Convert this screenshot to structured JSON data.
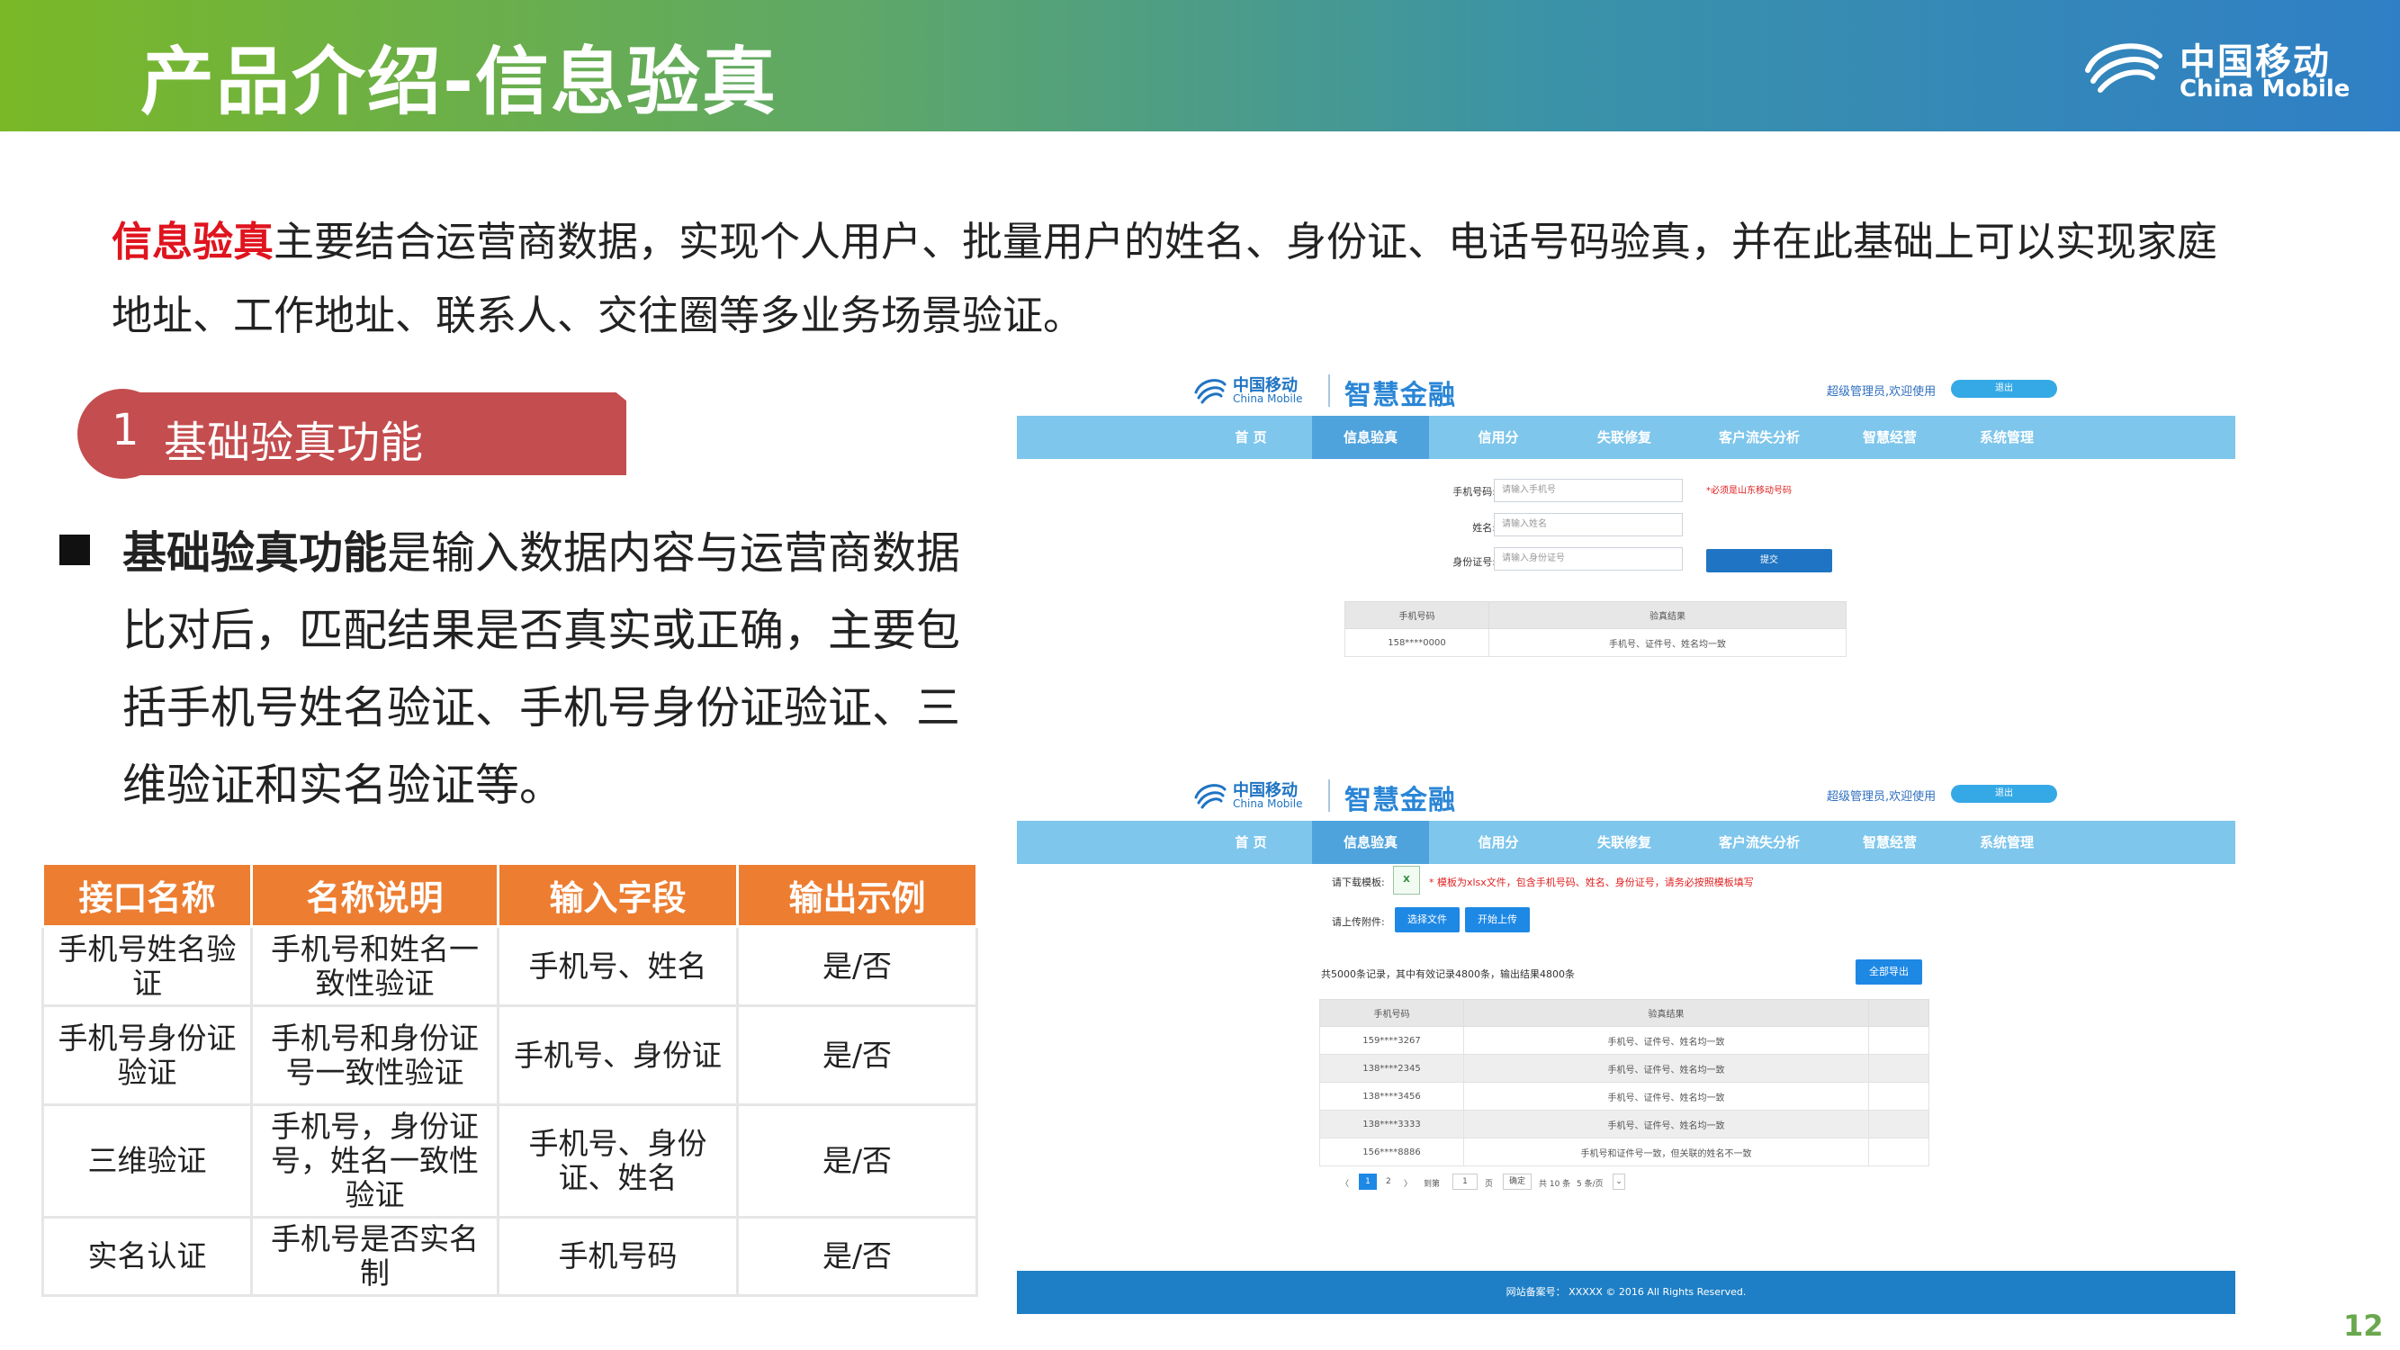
{
  "header": {
    "title": "产品介绍-信息验真",
    "brand_cn": "中国移动",
    "brand_en": "China Mobile"
  },
  "intro": {
    "highlight": "信息验真",
    "text": "主要结合运营商数据，实现个人用户、批量用户的姓名、身份证、电话号码验真，并在此基础上可以实现家庭地址、工作地址、联系人、交往圈等多业务场景验证。"
  },
  "section": {
    "number": "1",
    "label": "基础验真功能"
  },
  "bullet": {
    "bold": "基础验真功能",
    "text": "是输入数据内容与运营商数据比对后，匹配结果是否真实或正确，主要包括手机号姓名验证、手机号身份证验证、三维验证和实名验证等。"
  },
  "interface_table": {
    "headers": [
      "接口名称",
      "名称说明",
      "输入字段",
      "输出示例"
    ],
    "rows": [
      [
        "手机号姓名验证",
        "手机号和姓名一致性验证",
        "手机号、姓名",
        "是/否"
      ],
      [
        "手机号身份证验证",
        "手机号和身份证号一致性验证",
        "手机号、身份证",
        "是/否"
      ],
      [
        "三维验证",
        "手机号，身份证号，姓名一致性验证",
        "手机号、身份证、姓名",
        "是/否"
      ],
      [
        "实名认证",
        "手机号是否实名制",
        "手机号码",
        "是/否"
      ]
    ]
  },
  "app": {
    "logo_cn": "中国移动",
    "logo_en": "China Mobile",
    "product": "智慧金融",
    "user_text": "超级管理员,欢迎使用",
    "logout": "退出",
    "nav": [
      "首  页",
      "信息验真",
      "信用分",
      "失联修复",
      "客户流失分析",
      "智慧经营",
      "系统管理"
    ]
  },
  "form": {
    "phone_label": "手机号码:",
    "phone_placeholder": "请输入手机号",
    "phone_hint": "*必须是山东移动号码",
    "name_label": "姓名:",
    "name_placeholder": "请输入姓名",
    "id_label": "身份证号:",
    "id_placeholder": "请输入身份证号",
    "submit": "提交",
    "result_headers": [
      "手机号码",
      "验真结果"
    ],
    "result_row": [
      "158****0000",
      "手机号、证件号、姓名均一致"
    ]
  },
  "batch": {
    "template_label": "请下载模板:",
    "xls_icon": "X",
    "template_hint": "* 模板为xlsx文件，包含手机号码、姓名、身份证号，请务必按照模板填写",
    "upload_label": "请上传附件:",
    "choose_file": "选择文件",
    "start_upload": "开始上传",
    "summary": "共5000条记录，其中有效记录4800条，输出结果4800条",
    "export_all": "全部导出",
    "headers": [
      "手机号码",
      "验真结果"
    ],
    "rows": [
      [
        "159****3267",
        "手机号、证件号、姓名均一致"
      ],
      [
        "138****2345",
        "手机号、证件号、姓名均一致"
      ],
      [
        "138****3456",
        "手机号、证件号、姓名均一致"
      ],
      [
        "138****3333",
        "手机号、证件号、姓名均一致"
      ],
      [
        "156****8886",
        "手机号和证件号一致，但关联的姓名不一致"
      ]
    ],
    "pager": {
      "prev": "〈",
      "page1": "1",
      "page2": "2",
      "next": "〉",
      "goto": "到第",
      "goto_value": "1",
      "page_unit": "页",
      "confirm": "确定",
      "total": "共 10 条",
      "per_page": "5 条/页"
    },
    "footer": "网站备案号： XXXXX © 2016 All Rights Reserved."
  },
  "page_number": "12",
  "colors": {
    "accent_red": "#e0141e",
    "tag_red": "#c44d4f",
    "table_orange": "#ed7d31",
    "nav_blue": "#7ec6ec",
    "footer_blue": "#1e7fc6"
  }
}
